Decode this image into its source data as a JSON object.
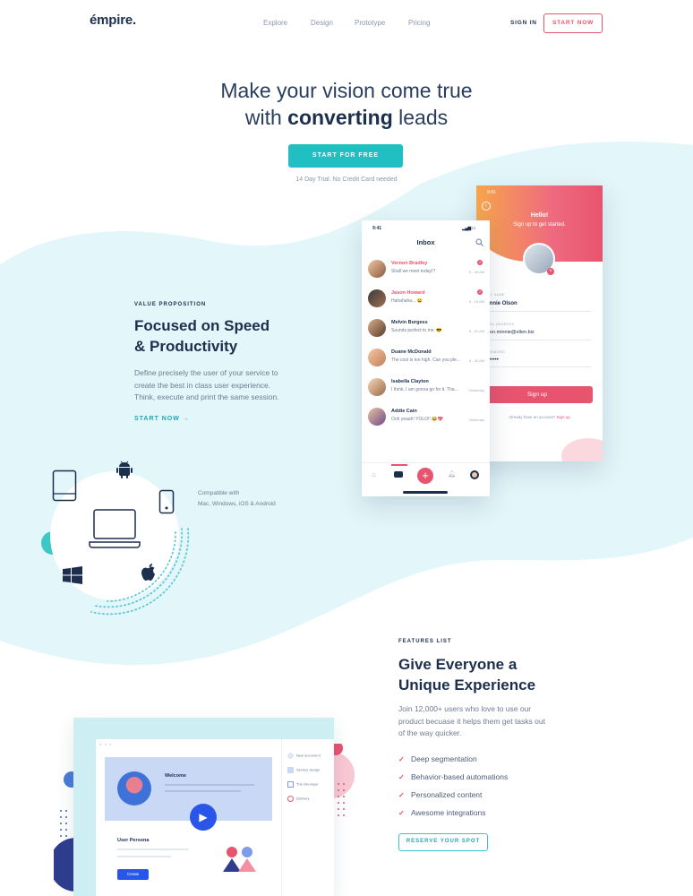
{
  "nav": {
    "logo": "émpire.",
    "links": [
      "Explore",
      "Design",
      "Prototype",
      "Pricing"
    ],
    "sign_in": "SIGN IN",
    "start_now": "START NOW"
  },
  "hero": {
    "title_line1": "Make your vision come true",
    "title_pre": "with",
    "title_bold": "converting",
    "title_post": "leads",
    "cta": "START FOR FREE",
    "trial_note": "14 Day Trial. No Credit Card needed"
  },
  "value": {
    "eyebrow": "VALUE PROPOSITION",
    "title_line1": "Focused on Speed",
    "title_line2": "& Productivity",
    "body_line1": "Define precisely the user of your service to",
    "body_line2": "create the best in class user experience.",
    "body_line3": "Think, execute and print the same session.",
    "link": "START NOW →"
  },
  "compat": {
    "line1": "Compatible with",
    "line2": "Mac, Windows, iOS & Android"
  },
  "inbox_phone": {
    "time": "9:41",
    "title": "Inbox",
    "messages": [
      {
        "name": "Vernon Bradley",
        "msg": "Shall we meet today!?",
        "time": "9 - 40 AM",
        "badge": "2",
        "highlight": true
      },
      {
        "name": "Jason Howard",
        "msg": "Hahahaha... 😄",
        "time": "9 - 16 AM",
        "badge": "2",
        "highlight": true
      },
      {
        "name": "Melvin Burgess",
        "msg": "Sounds perfect to me. 😎",
        "time": "8 - 51 AM",
        "badge": "",
        "highlight": false
      },
      {
        "name": "Duane McDonald",
        "msg": "The cost is too high. Can you ple...",
        "time": "8 - 40 AM",
        "badge": "",
        "highlight": false
      },
      {
        "name": "Isabella Clayton",
        "msg": "I think, I am gonna go for it. Tha...",
        "time": "Yesterday",
        "badge": "",
        "highlight": false
      },
      {
        "name": "Addie Cain",
        "msg": "Ooh yeaah! YOLO!! 😂💖",
        "time": "Yesterday",
        "badge": "",
        "highlight": false
      }
    ]
  },
  "signup_phone": {
    "time": "9:41",
    "hello": "Hello!",
    "subtitle": "Sign up to get started.",
    "full_name_label": "FULL NAME",
    "full_name": "Minnie Olson",
    "email_label": "EMAIL ADDRESS",
    "email": "olson.minnie@ellen.biz",
    "password_label": "PASSWORD",
    "password": "••••••••",
    "button": "Sign up",
    "have_account": "Already have an account?",
    "signin": "Sign up"
  },
  "features": {
    "eyebrow": "FEATURES LIST",
    "title_line1": "Give Everyone a",
    "title_line2": "Unique Experience",
    "body_line1": "Join 12,000+ users who love to use our",
    "body_line2": "product becuase it helps them get tasks out",
    "body_line3": "of the way quicker.",
    "items": [
      "Deep segmentation",
      "Behavior-based automations",
      "Personalized content",
      "Awesome integrations"
    ],
    "cta": "RESERVE YOUR SPOT"
  },
  "mockup": {
    "welcome": "Welcome",
    "persona": "User Persona",
    "create": "Create",
    "side_items": [
      "New document",
      "Service design",
      "The Inkumper",
      "Delivery"
    ]
  },
  "colors": {
    "teal": "#21bfc1",
    "pink": "#e8546e",
    "navy": "#1c2f4d",
    "blob": "#e3f6f9"
  }
}
